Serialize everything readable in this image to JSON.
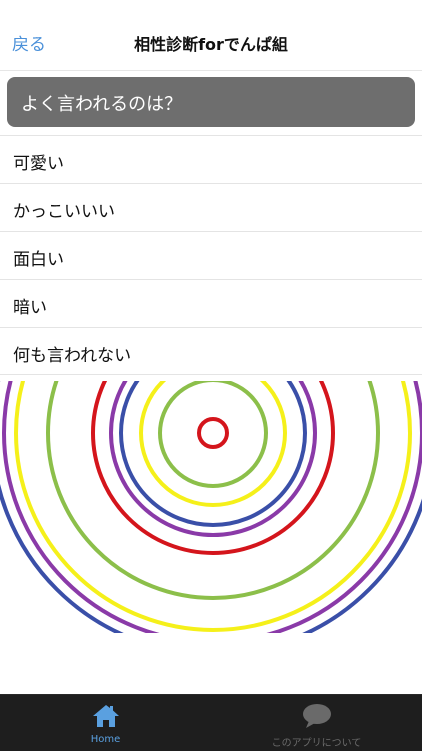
{
  "navbar": {
    "back_label": "戻る",
    "title": "相性診断forでんぱ組"
  },
  "question": {
    "text": "よく言われるのは？"
  },
  "answers": [
    {
      "label": "可愛い"
    },
    {
      "label": "かっこいいい"
    },
    {
      "label": "面白い"
    },
    {
      "label": "暗い"
    },
    {
      "label": "何も言われない"
    }
  ],
  "rings": {
    "colors": {
      "red": "#d4151c",
      "yellow": "#f5f01a",
      "green": "#8cbf4a",
      "blue": "#3a4fa8",
      "purple": "#8a3aa8"
    }
  },
  "tabbar": {
    "home_label": "Home",
    "home_icon": "home-icon",
    "about_label": "このアプリについて",
    "about_icon": "speech-bubble-icon",
    "active_color": "#5aa0e0",
    "inactive_color": "#6a6a6a"
  }
}
